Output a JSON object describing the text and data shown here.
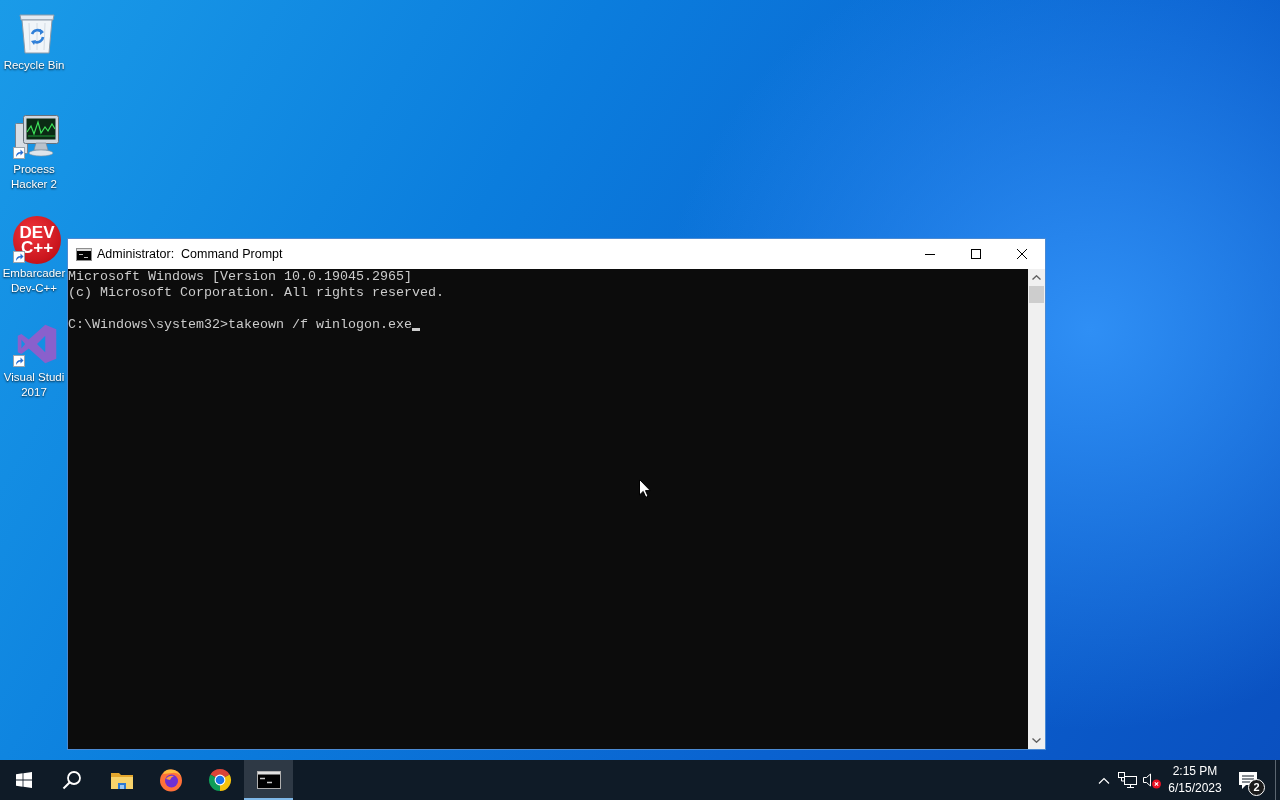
{
  "desktop_icons": [
    {
      "label": "Recycle Bin",
      "kind": "recycle_bin",
      "shortcut": false
    },
    {
      "label": "Process Hacker 2",
      "kind": "monitor",
      "shortcut": true
    },
    {
      "label": "Embarcader Dev-C++",
      "kind": "text_logo",
      "logo_text": "DEV C++",
      "shortcut": true
    },
    {
      "label": "Visual Studi 2017",
      "kind": "ribbon_logo",
      "shortcut": true
    }
  ],
  "window": {
    "title": "Administrator:  Command Prompt",
    "console": {
      "output": [
        "Microsoft Windows [Version 10.0.19045.2965]",
        "(c) Microsoft Corporation. All rights reserved."
      ],
      "input_line": "C:\\Windows\\system32>takeown /f winlogon.exe"
    }
  },
  "taskbar": {
    "apps": [
      {
        "kind": "folder",
        "selected": false
      },
      {
        "kind": "fox_browser",
        "selected": false
      },
      {
        "kind": "round_browser",
        "selected": false
      },
      {
        "kind": "console",
        "selected": true
      }
    ],
    "tray": {
      "volume_muted": true,
      "time": "2:15 PM",
      "date": "6/15/2023",
      "notification_count": "2"
    }
  }
}
